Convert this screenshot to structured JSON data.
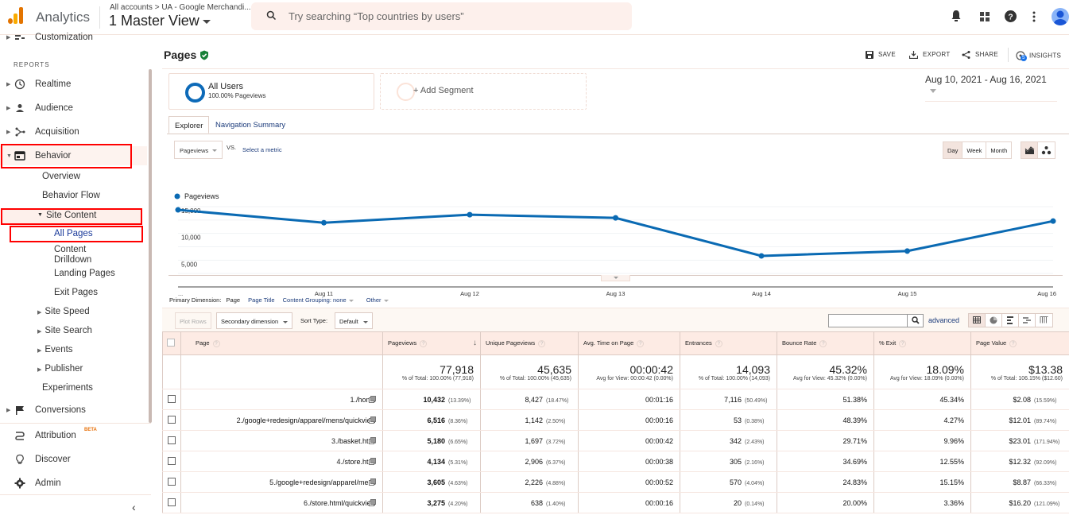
{
  "header": {
    "app_name": "Analytics",
    "breadcrumb": "All accounts > UA - Google Merchandi...",
    "view_name": "1 Master View",
    "search_placeholder": "Try searching “Top countries by users”",
    "icons": [
      "bell-icon",
      "apps-grid-icon",
      "help-icon",
      "more-vert-icon",
      "account-avatar"
    ]
  },
  "sidebar": {
    "top_item": "Customization",
    "section_label": "REPORTS",
    "items": [
      {
        "label": "Realtime",
        "icon": "clock-icon"
      },
      {
        "label": "Audience",
        "icon": "person-icon"
      },
      {
        "label": "Acquisition",
        "icon": "acquisition-icon"
      },
      {
        "label": "Behavior",
        "icon": "behavior-icon"
      }
    ],
    "behavior_children": [
      "Overview",
      "Behavior Flow"
    ],
    "site_content": "Site Content",
    "site_content_children": [
      "All Pages",
      "Content Drilldown",
      "Landing Pages",
      "Exit Pages"
    ],
    "content_drilldown_line1": "Content",
    "content_drilldown_line2": "Drilldown",
    "behavior_more": [
      "Site Speed",
      "Site Search",
      "Events",
      "Publisher"
    ],
    "experiments": "Experiments",
    "conversions": "Conversions",
    "attribution": "Attribution",
    "attribution_badge": "BETA",
    "discover": "Discover",
    "admin": "Admin"
  },
  "report": {
    "title": "Pages",
    "actions": {
      "save": "SAVE",
      "export": "EXPORT",
      "share": "SHARE",
      "insights": "INSIGHTS",
      "insights_badge": "5"
    },
    "date_range": "Aug 10, 2021 - Aug 16, 2021",
    "segments": {
      "all_users_title": "All Users",
      "all_users_sub": "100.00% Pageviews",
      "add_segment": "+ Add Segment"
    },
    "tabs": [
      "Explorer",
      "Navigation Summary"
    ],
    "metric_selector": "Pageviews",
    "vs": "VS.",
    "select_metric": "Select a metric",
    "granularity": [
      "Day",
      "Week",
      "Month"
    ],
    "granularity_active": "Day"
  },
  "chart_data": {
    "type": "line",
    "legend": "Pageviews",
    "x": [
      "...",
      "Aug 11",
      "Aug 12",
      "Aug 13",
      "Aug 14",
      "Aug 15",
      "Aug 16"
    ],
    "series": [
      {
        "name": "Pageviews",
        "values": [
          14400,
          12000,
          13500,
          12900,
          5800,
          6700,
          12300
        ]
      }
    ],
    "yticks": [
      "5,000",
      "10,000",
      "15,000"
    ],
    "ylim": [
      0,
      15000
    ],
    "color": "#0a6ab3",
    "grid": true
  },
  "table": {
    "primary_dimension_label": "Primary Dimension:",
    "primary_dimension_active": "Page",
    "primary_dimension_links": [
      "Page Title",
      "Content Grouping: none",
      "Other"
    ],
    "plot_rows": "Plot Rows",
    "secondary_dimension": "Secondary dimension",
    "sort_type_label": "Sort Type:",
    "sort_type_value": "Default",
    "advanced": "advanced",
    "columns": [
      "Page",
      "Pageviews",
      "Unique Pageviews",
      "Avg. Time on Page",
      "Entrances",
      "Bounce Rate",
      "% Exit",
      "Page Value"
    ],
    "totals": [
      {
        "value": "77,918",
        "sub": "% of Total: 100.00% (77,918)"
      },
      {
        "value": "45,635",
        "sub": "% of Total: 100.00% (45,635)"
      },
      {
        "value": "00:00:42",
        "sub": "Avg for View: 00:00:42 (0.00%)"
      },
      {
        "value": "14,093",
        "sub": "% of Total: 100.00% (14,093)"
      },
      {
        "value": "45.32%",
        "sub": "Avg for View: 45.32% (0.00%)"
      },
      {
        "value": "18.09%",
        "sub": "Avg for View: 18.09% (0.00%)"
      },
      {
        "value": "$13.38",
        "sub": "% of Total: 106.15% ($12.60)"
      }
    ],
    "rows": [
      {
        "n": "1.",
        "page": "/home",
        "pv": "10,432",
        "pv_pct": "(13.39%)",
        "upv": "8,427",
        "upv_pct": "(18.47%)",
        "time": "00:01:16",
        "ent": "7,116",
        "ent_pct": "(50.49%)",
        "bounce": "51.38%",
        "exit": "45.34%",
        "value": "$2.08",
        "value_pct": "(15.59%)"
      },
      {
        "n": "2.",
        "page": "/google+redesign/apparel/mens/quickview",
        "pv": "6,516",
        "pv_pct": "(8.36%)",
        "upv": "1,142",
        "upv_pct": "(2.50%)",
        "time": "00:00:16",
        "ent": "53",
        "ent_pct": "(0.38%)",
        "bounce": "48.39%",
        "exit": "4.27%",
        "value": "$12.01",
        "value_pct": "(89.74%)"
      },
      {
        "n": "3.",
        "page": "/basket.html",
        "pv": "5,180",
        "pv_pct": "(6.65%)",
        "upv": "1,697",
        "upv_pct": "(3.72%)",
        "time": "00:00:42",
        "ent": "342",
        "ent_pct": "(2.43%)",
        "bounce": "29.71%",
        "exit": "9.96%",
        "value": "$23.01",
        "value_pct": "(171.94%)"
      },
      {
        "n": "4.",
        "page": "/store.html",
        "pv": "4,134",
        "pv_pct": "(5.31%)",
        "upv": "2,906",
        "upv_pct": "(6.37%)",
        "time": "00:00:38",
        "ent": "305",
        "ent_pct": "(2.16%)",
        "bounce": "34.69%",
        "exit": "12.55%",
        "value": "$12.32",
        "value_pct": "(92.09%)"
      },
      {
        "n": "5.",
        "page": "/google+redesign/apparel/mens",
        "pv": "3,605",
        "pv_pct": "(4.63%)",
        "upv": "2,226",
        "upv_pct": "(4.88%)",
        "time": "00:00:52",
        "ent": "570",
        "ent_pct": "(4.04%)",
        "bounce": "24.83%",
        "exit": "15.15%",
        "value": "$8.87",
        "value_pct": "(66.33%)"
      },
      {
        "n": "6.",
        "page": "/store.html/quickview",
        "pv": "3,275",
        "pv_pct": "(4.20%)",
        "upv": "638",
        "upv_pct": "(1.40%)",
        "time": "00:00:16",
        "ent": "20",
        "ent_pct": "(0.14%)",
        "bounce": "20.00%",
        "exit": "3.36%",
        "value": "$16.20",
        "value_pct": "(121.09%)"
      }
    ]
  }
}
